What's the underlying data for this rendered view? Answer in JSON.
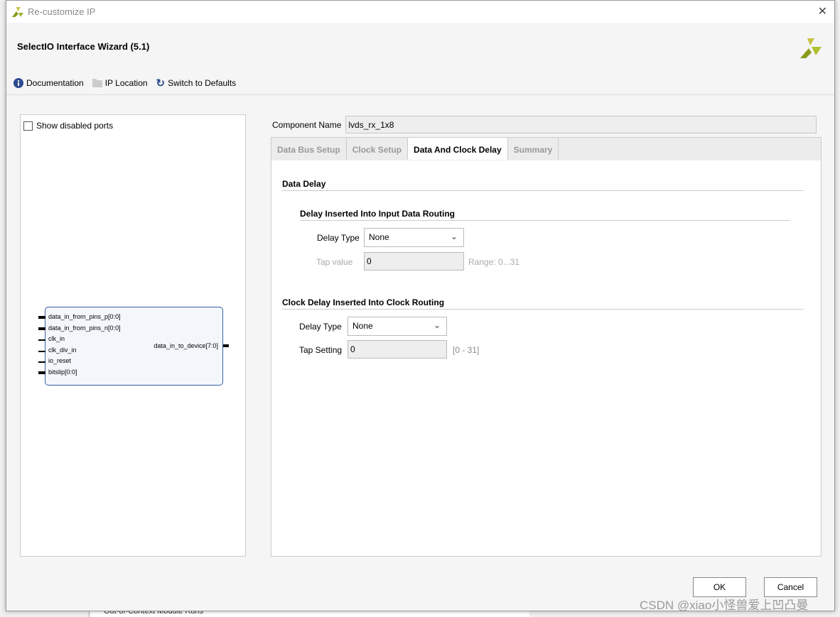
{
  "window": {
    "title": "Re-customize IP",
    "close": "✕"
  },
  "header": {
    "title": "SelectIO Interface Wizard (5.1)"
  },
  "toolbar": {
    "documentation": "Documentation",
    "ip_location": "IP Location",
    "switch_defaults": "Switch to Defaults"
  },
  "left": {
    "show_disabled": "Show disabled ports",
    "show_disabled_checked": false,
    "inputs": [
      "data_in_from_pins_p[0:0]",
      "data_in_from_pins_n[0:0]",
      "clk_in",
      "clk_div_in",
      "io_reset",
      "bitslip[0:0]"
    ],
    "output": "data_in_to_device[7:0]"
  },
  "component": {
    "label": "Component Name",
    "value": "lvds_rx_1x8"
  },
  "tabs": [
    {
      "label": "Data Bus Setup"
    },
    {
      "label": "Clock Setup"
    },
    {
      "label": "Data And Clock Delay",
      "active": true
    },
    {
      "label": "Summary"
    }
  ],
  "data_delay": {
    "title": "Data Delay",
    "subtitle": "Delay Inserted Into Input Data Routing",
    "delay_type_label": "Delay Type",
    "delay_type": "None",
    "tap_label": "Tap value",
    "tap_value": "0",
    "range": "Range: 0...31"
  },
  "clock_delay": {
    "title": "Clock Delay Inserted Into Clock Routing",
    "delay_type_label": "Delay Type",
    "delay_type": "None",
    "tap_label": "Tap Setting",
    "tap_value": "0",
    "range": "[0 - 31]"
  },
  "buttons": {
    "ok": "OK",
    "cancel": "Cancel"
  },
  "background": {
    "tree_item": "Out-of-Context Module Runs"
  },
  "watermark": "CSDN @xiao小怪兽爱上凹凸曼"
}
